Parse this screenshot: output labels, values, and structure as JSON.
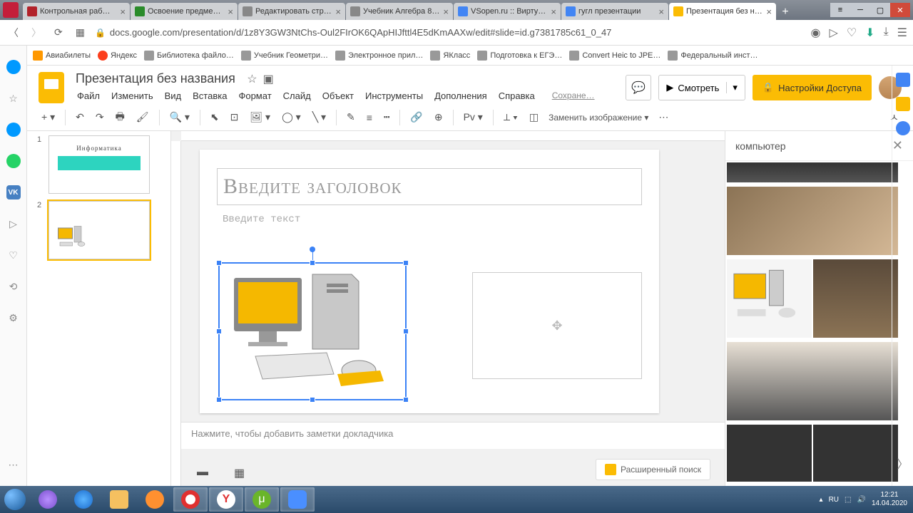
{
  "browser": {
    "tabs": [
      {
        "label": "Контрольная раб…"
      },
      {
        "label": "Освоение предме…"
      },
      {
        "label": "Редактировать стр…"
      },
      {
        "label": "Учебник Алгебра 8…"
      },
      {
        "label": "VSopen.ru :: Вирту…"
      },
      {
        "label": "гугл презентации"
      },
      {
        "label": "Презентация без н…"
      }
    ],
    "url": "docs.google.com/presentation/d/1z8Y3GW3NtChs-Oul2FIrOK6QApHIJfttl4E5dKmAAXw/edit#slide=id.g7381785c61_0_47",
    "bookmarks": [
      "Авиабилеты",
      "Яндекс",
      "Библиотека файло…",
      "Учебник Геометри…",
      "Электронное прил…",
      "ЯКласс",
      "Подготовка к ЕГЭ…",
      "Convert Heic to JPE…",
      "Федеральный инст…"
    ]
  },
  "slides": {
    "doc_title": "Презентация без названия",
    "menus": [
      "Файл",
      "Изменить",
      "Вид",
      "Вставка",
      "Формат",
      "Слайд",
      "Объект",
      "Инструменты",
      "Дополнения",
      "Справка"
    ],
    "saving": "Сохране…",
    "view_btn": "Смотреть",
    "share_btn": "Настройки Доступа",
    "replace_image": "Заменить изображение",
    "thumb1_title": "Информатика",
    "slide": {
      "title_placeholder": "Введите заголовок",
      "subtitle_placeholder": "Введите текст"
    },
    "notes_placeholder": "Нажмите, чтобы добавить заметки докладчика",
    "advanced_search": "Расширенный поиск"
  },
  "explore": {
    "search_term": "компьютер"
  },
  "taskbar": {
    "lang": "RU",
    "time": "12:21",
    "date": "14.04.2020"
  }
}
